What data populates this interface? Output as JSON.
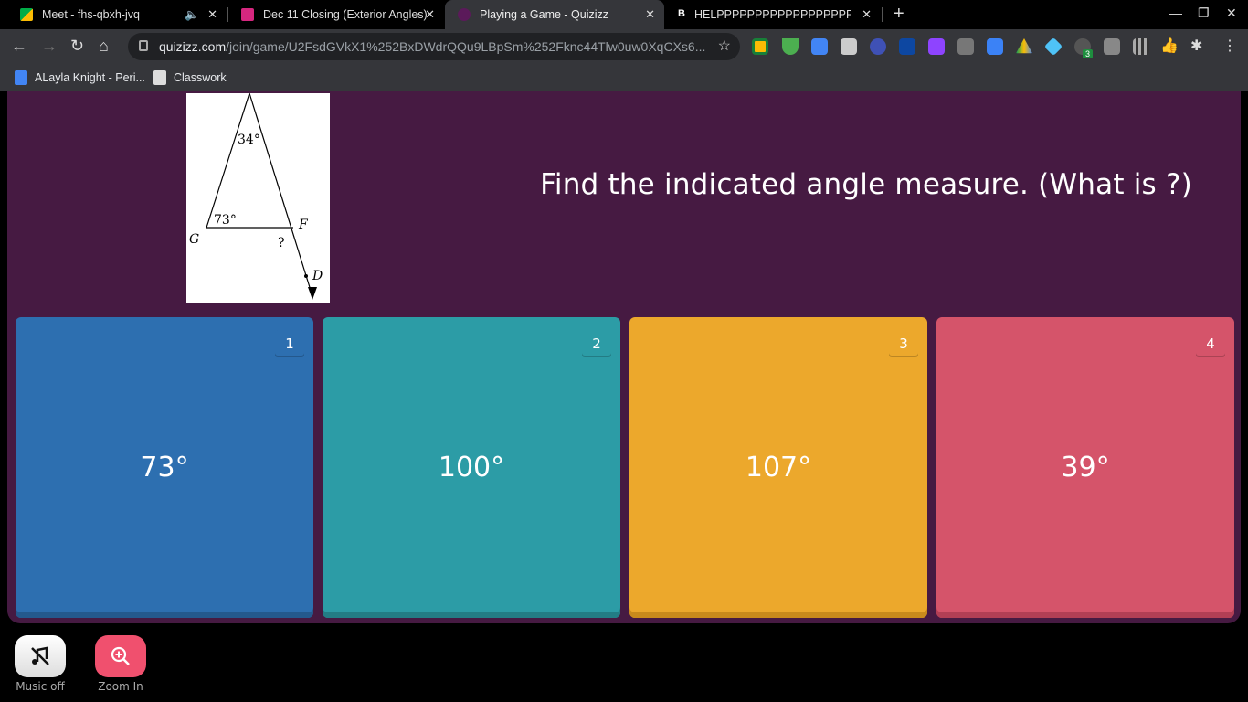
{
  "browser": {
    "tabs": [
      {
        "title": "Meet - fhs-qbxh-jvq",
        "favicon": "google-meet-icon",
        "muted": true
      },
      {
        "title": "Dec 11 Closing (Exterior Angles)",
        "favicon": "classroom-assignment-icon"
      },
      {
        "title": "Playing a Game - Quizizz",
        "favicon": "quizizz-icon",
        "active": true
      },
      {
        "title": "HELPPPPPPPPPPPPPPPPPPP",
        "favicon": "brainly-icon"
      }
    ],
    "url_host": "quizizz.com",
    "url_path": "/join/game/U2FsdGVkX1%252BxDWdrQQu9LBpSm%252Fknc44Tlw0uw0XqCXs6...",
    "extension_badge": "3",
    "bookmarks": [
      "ALayla Knight - Peri...",
      "Classwork"
    ]
  },
  "question": {
    "text": "Find the indicated angle measure. (What is ?)",
    "figure": {
      "top_angle": "34°",
      "base_angle": "73°",
      "label_g": "G",
      "label_f": "F",
      "label_d": "D",
      "unknown": "?"
    }
  },
  "options": [
    {
      "number": "1",
      "answer": "73°",
      "color": "#2d6fb0"
    },
    {
      "number": "2",
      "answer": "100°",
      "color": "#2c9ca6"
    },
    {
      "number": "3",
      "answer": "107°",
      "color": "#eca82c"
    },
    {
      "number": "4",
      "answer": "39°",
      "color": "#d5546a"
    }
  ],
  "footer": {
    "music_label": "Music off",
    "zoom_label": "Zoom In"
  }
}
